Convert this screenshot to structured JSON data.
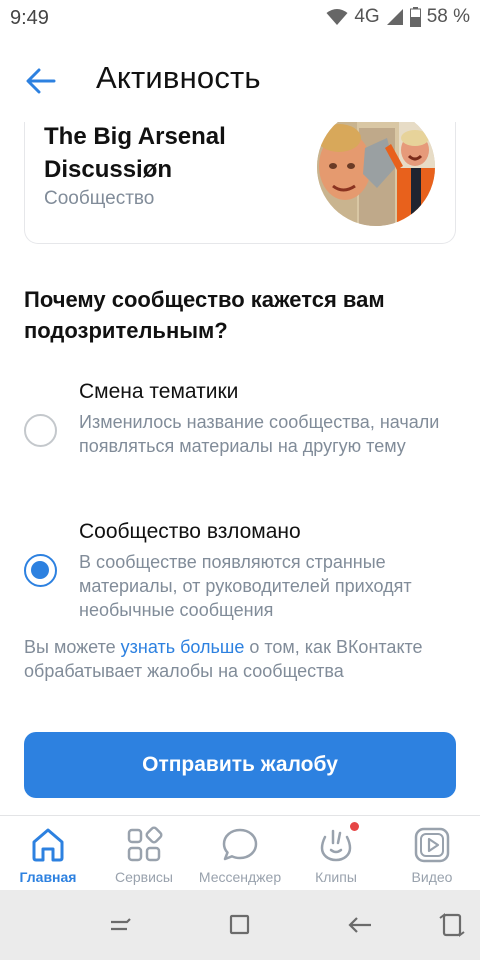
{
  "status_bar": {
    "time": "9:49",
    "network": "4G",
    "battery": "58 %"
  },
  "app_bar": {
    "back_icon": "arrow-left-icon",
    "title": "Активность"
  },
  "community": {
    "name": "The Big Arsenal Discussiøn",
    "type": "Сообщество"
  },
  "question": "Почему сообщество кажется вам подозрительным?",
  "options": [
    {
      "title": "Смена тематики",
      "description": "Изменилось название сообщества, начали появляться материалы на другую тему",
      "selected": false
    },
    {
      "title": "Сообщество взломано",
      "description": "В сообществе появляются странные материалы, от руководителей приходят необычные сообщения",
      "selected": true
    }
  ],
  "info": {
    "before": "Вы можете ",
    "link": "узнать больше",
    "after": " о том, как ВКонтакте обрабатывает жалобы на сообщества"
  },
  "submit_label": "Отправить жалобу",
  "tabs": [
    {
      "label": "Главная",
      "icon": "home-icon",
      "active": true
    },
    {
      "label": "Сервисы",
      "icon": "services-icon",
      "active": false
    },
    {
      "label": "Мессенджер",
      "icon": "messenger-icon",
      "active": false
    },
    {
      "label": "Клипы",
      "icon": "clips-icon",
      "active": false,
      "notification": true
    },
    {
      "label": "Видео",
      "icon": "video-icon",
      "active": false
    }
  ],
  "system_nav": [
    "recents-icon",
    "home-square-icon",
    "back-icon",
    "rotate-icon"
  ],
  "colors": {
    "accent": "#2d81e0",
    "secondary_text": "#818c99",
    "notification": "#e64646"
  }
}
